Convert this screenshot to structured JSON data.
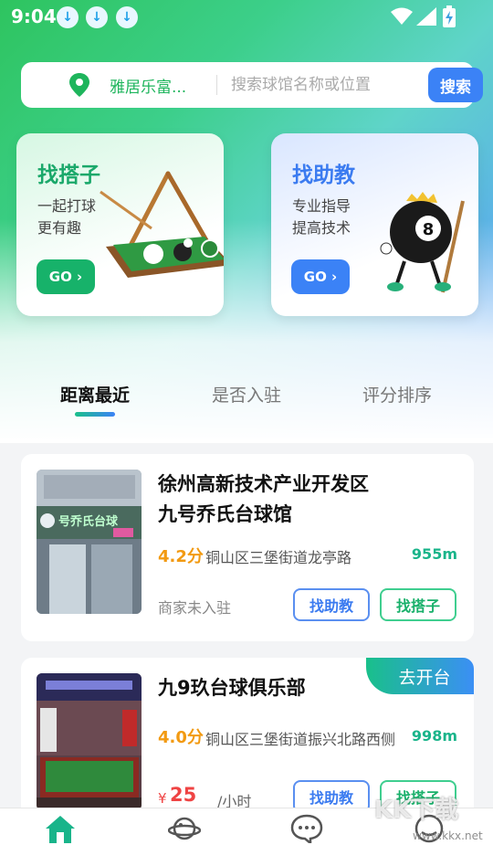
{
  "status_bar": {
    "time": "9:04",
    "download_glyph": "↓"
  },
  "search": {
    "location": "雅居乐富...",
    "placeholder": "搜索球馆名称或位置",
    "button_label": "搜索"
  },
  "feature_cards": [
    {
      "title": "找搭子",
      "line1": "一起打球",
      "line2": "更有趣",
      "go_label": "GO ›",
      "icon": "billiard-table-icon"
    },
    {
      "title": "找助教",
      "line1": "专业指导",
      "line2": "提高技术",
      "go_label": "GO ›",
      "icon": "eight-ball-mascot-icon"
    }
  ],
  "sort_tabs": [
    {
      "label": "距离最近",
      "active": true
    },
    {
      "label": "是否入驻",
      "active": false
    },
    {
      "label": "评分排序",
      "active": false
    }
  ],
  "venues": [
    {
      "name": "徐州高新技术产业开发区九号乔氏台球馆",
      "rating": "4.2分",
      "address": "铜山区三堡街道龙亭路",
      "distance": "955m",
      "status": "商家未入驻",
      "coach_label": "找助教",
      "partner_label": "找搭子",
      "sign_text": "号乔氏台球"
    },
    {
      "name": "九9玖台球俱乐部",
      "badge": "去开台",
      "rating": "4.0分",
      "address": "铜山区三堡街道振兴北路西侧",
      "distance": "998m",
      "price_symbol": "¥",
      "price": "25",
      "price_unit": "/小时",
      "coach_label": "找助教",
      "partner_label": "找搭子"
    }
  ],
  "bottom_nav": [
    {
      "icon": "home-icon",
      "active": true
    },
    {
      "icon": "planet-icon",
      "active": false
    },
    {
      "icon": "chat-bubble-icon",
      "active": false
    },
    {
      "icon": "profile-icon",
      "active": false
    }
  ],
  "watermark": {
    "text": "KK下载",
    "url": "www.kkx.net"
  },
  "colors": {
    "primary_green": "#17b26a",
    "primary_blue": "#3b82f6",
    "rating_orange": "#f29a12",
    "price_red": "#ef4444"
  }
}
